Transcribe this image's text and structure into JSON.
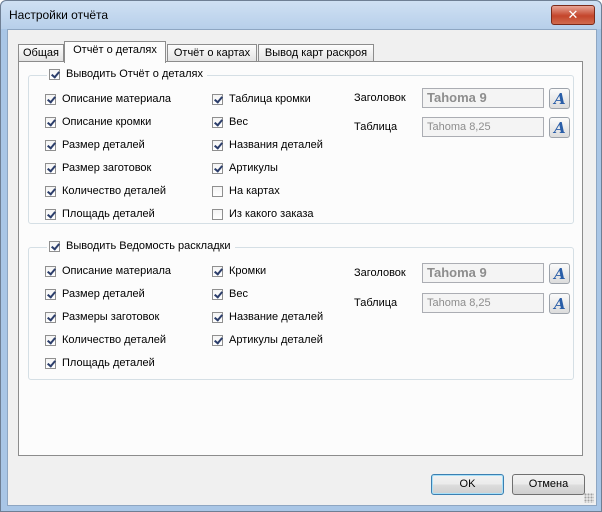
{
  "window": {
    "title": "Настройки отчёта",
    "close_label": "✕"
  },
  "tabs": [
    {
      "label": "Общая"
    },
    {
      "label": "Отчёт о деталях"
    },
    {
      "label": "Отчёт о картах"
    },
    {
      "label": "Вывод карт раскроя"
    }
  ],
  "group1": {
    "legend": "Выводить Отчёт о деталях",
    "legend_checked": true,
    "left": [
      {
        "label": "Описание материала",
        "checked": true
      },
      {
        "label": "Описание кромки",
        "checked": true
      },
      {
        "label": "Размер деталей",
        "checked": true
      },
      {
        "label": "Размер заготовок",
        "checked": true
      },
      {
        "label": "Количество деталей",
        "checked": true
      },
      {
        "label": "Площадь деталей",
        "checked": true
      }
    ],
    "right": [
      {
        "label": "Таблица кромки",
        "checked": true
      },
      {
        "label": "Вес",
        "checked": true
      },
      {
        "label": "Названия деталей",
        "checked": true
      },
      {
        "label": "Артикулы",
        "checked": true
      },
      {
        "label": "На картах",
        "checked": false
      },
      {
        "label": "Из какого заказа",
        "checked": false
      }
    ],
    "header_label": "Заголовок",
    "header_font": "Tahoma  9",
    "table_label": "Таблица",
    "table_font": "Tahoma  8,25"
  },
  "group2": {
    "legend": "Выводить Ведомость раскладки",
    "legend_checked": true,
    "left": [
      {
        "label": "Описание материала",
        "checked": true
      },
      {
        "label": "Размер деталей",
        "checked": true
      },
      {
        "label": "Размеры заготовок",
        "checked": true
      },
      {
        "label": "Количество деталей",
        "checked": true
      },
      {
        "label": "Площадь деталей",
        "checked": true
      }
    ],
    "right": [
      {
        "label": "Кромки",
        "checked": true
      },
      {
        "label": "Вес",
        "checked": true
      },
      {
        "label": "Название деталей",
        "checked": true
      },
      {
        "label": "Артикулы деталей",
        "checked": true
      }
    ],
    "header_label": "Заголовок",
    "header_font": "Tahoma  9",
    "table_label": "Таблица",
    "table_font": "Tahoma  8,25"
  },
  "buttons": {
    "ok": "OK",
    "cancel": "Отмена"
  },
  "icons": {
    "font_button": "font-picker-icon",
    "font_glyph": "A"
  }
}
